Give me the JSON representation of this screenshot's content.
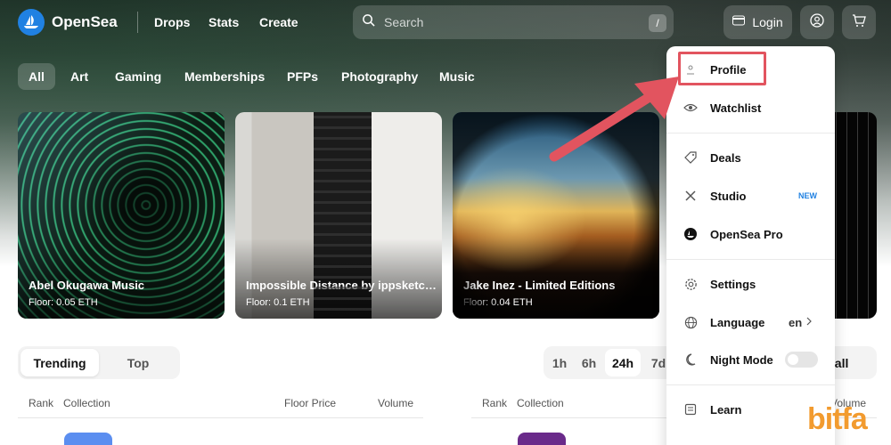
{
  "nav": {
    "brand": "OpenSea",
    "links": [
      "Drops",
      "Stats",
      "Create"
    ],
    "search_placeholder": "Search",
    "search_shortcut": "/",
    "login_label": "Login"
  },
  "categories": [
    "All",
    "Art",
    "Gaming",
    "Memberships",
    "PFPs",
    "Photography",
    "Music"
  ],
  "active_category": "All",
  "cards": [
    {
      "title": "Abel Okugawa Music",
      "floor": "Floor: 0.05 ETH"
    },
    {
      "title": "Impossible Distance by ippsketch...",
      "floor": "Floor: 0.1 ETH"
    },
    {
      "title": "Jake Inez - Limited Editions",
      "floor": "Floor: 0.04 ETH"
    }
  ],
  "rankings": {
    "tabs": [
      "Trending",
      "Top"
    ],
    "active_tab": "Trending",
    "time_ranges": [
      "1h",
      "6h",
      "24h",
      "7d"
    ],
    "active_range": "24h",
    "view_all": "w all",
    "left_columns": [
      "Rank",
      "Collection",
      "Floor Price",
      "Volume"
    ],
    "right_columns": [
      "Rank",
      "Collection",
      "Volume"
    ]
  },
  "menu": {
    "items": [
      {
        "label": "Profile",
        "icon": "user-icon"
      },
      {
        "label": "Watchlist",
        "icon": "eye-icon"
      },
      {
        "label": "Deals",
        "icon": "tag-icon"
      },
      {
        "label": "Studio",
        "icon": "tools-icon",
        "badge": "NEW"
      },
      {
        "label": "OpenSea Pro",
        "icon": "opensea-pro-icon"
      },
      {
        "label": "Settings",
        "icon": "gear-icon"
      },
      {
        "label": "Language",
        "icon": "globe-icon",
        "value": "en"
      },
      {
        "label": "Night Mode",
        "icon": "moon-icon",
        "toggle": false
      },
      {
        "label": "Learn",
        "icon": "book-icon"
      }
    ]
  },
  "watermark": "bitfa",
  "colors": {
    "accent": "#2081e2",
    "highlight": "#e2545f",
    "watermark": "#f29b2f"
  }
}
